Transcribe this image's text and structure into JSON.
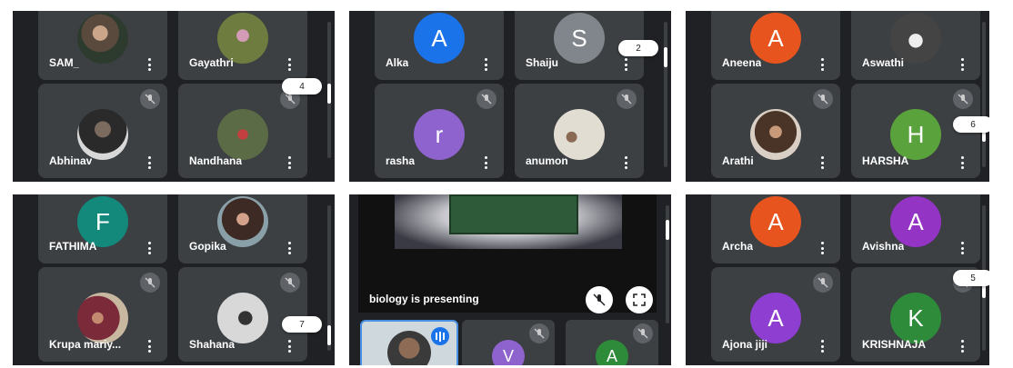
{
  "panels": [
    {
      "page_badge": "4",
      "tiles": [
        {
          "name": "SAM_",
          "avatar": "photo",
          "muted": false
        },
        {
          "name": "Gayathri",
          "avatar": "photo",
          "muted": false
        },
        {
          "name": "Abhinav",
          "avatar": "photo",
          "muted": true
        },
        {
          "name": "Nandhana",
          "avatar": "photo",
          "muted": true
        }
      ]
    },
    {
      "page_badge": "2",
      "tiles": [
        {
          "name": "Alka",
          "initial": "A",
          "color": "#1a73e8",
          "muted": false
        },
        {
          "name": "Shaiju",
          "initial": "S",
          "color": "#80868b",
          "muted": false
        },
        {
          "name": "rasha",
          "initial": "r",
          "color": "#8e63ce",
          "muted": true
        },
        {
          "name": "anumon",
          "avatar": "photo",
          "muted": true
        }
      ]
    },
    {
      "page_badge": "6",
      "tiles": [
        {
          "name": "Aneena",
          "initial": "A",
          "color": "#e8541e",
          "muted": false
        },
        {
          "name": "Aswathi",
          "avatar": "photo",
          "muted": false
        },
        {
          "name": "Arathi",
          "avatar": "photo",
          "muted": true
        },
        {
          "name": "HARSHA",
          "initial": "H",
          "color": "#5aa33c",
          "muted": true
        }
      ]
    },
    {
      "page_badge": "7",
      "tiles": [
        {
          "name": "FATHIMA",
          "initial": "F",
          "color": "#12897b",
          "muted": false
        },
        {
          "name": "Gopika",
          "avatar": "photo",
          "muted": false
        },
        {
          "name": "Krupa mariy...",
          "avatar": "photo",
          "muted": true
        },
        {
          "name": "Shahana",
          "avatar": "photo",
          "muted": true
        }
      ]
    },
    {
      "presenting_text": "biology is presenting",
      "small_tiles": [
        {
          "initial": "V",
          "color": "#8e63ce"
        },
        {
          "initial": "A",
          "color": "#2e8b3a"
        }
      ]
    },
    {
      "page_badge": "5",
      "tiles": [
        {
          "name": "Archa",
          "initial": "A",
          "color": "#e8541e",
          "muted": false
        },
        {
          "name": "Avishna",
          "initial": "A",
          "color": "#9334c4",
          "muted": false
        },
        {
          "name": "Ajona jiji",
          "initial": "A",
          "color": "#8e3fd1",
          "muted": true
        },
        {
          "name": "KRISHNAJA",
          "initial": "K",
          "color": "#2e8b3a",
          "muted": true
        }
      ]
    }
  ]
}
